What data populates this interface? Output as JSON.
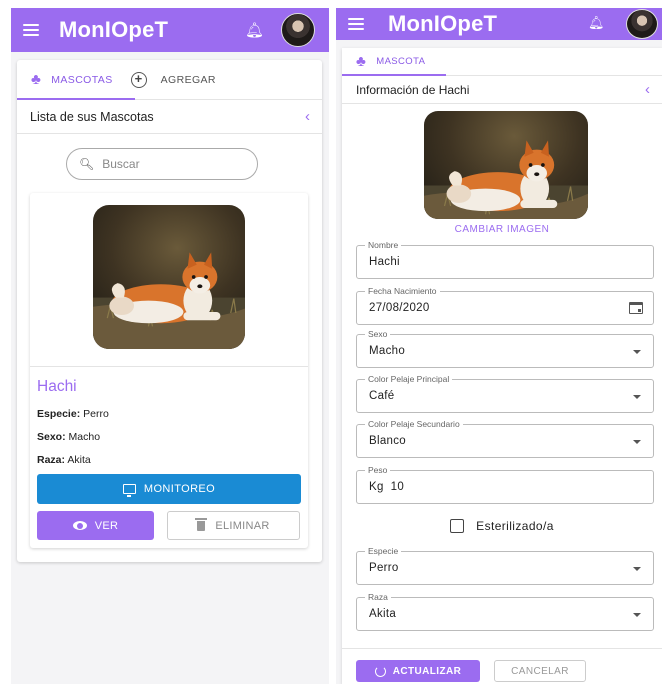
{
  "app": {
    "brand": "MonIOpeT"
  },
  "icons": {
    "menu": "hamburger-icon",
    "notifications": "bell-icon",
    "avatar": "user-avatar",
    "paw": "paw-icon",
    "add": "plus-circle-icon",
    "back": "chevron-left-icon",
    "search": "search-icon",
    "monitor": "monitor-icon",
    "view": "eye-icon",
    "delete": "trash-icon",
    "calendar": "calendar-icon",
    "dropdown": "caret-down-icon",
    "refresh": "refresh-icon"
  },
  "colors": {
    "primary": "#9b6cf0",
    "info": "#1a8bd4"
  },
  "list_view": {
    "tabs": [
      {
        "label": "MASCOTAS"
      },
      {
        "label": "AGREGAR"
      }
    ],
    "section_title": "Lista de sus Mascotas",
    "search": {
      "placeholder": "Buscar"
    },
    "pet": {
      "name": "Hachi",
      "especie_label": "Especie:",
      "especie": "Perro",
      "sexo_label": "Sexo:",
      "sexo": "Macho",
      "raza_label": "Raza:",
      "raza": "Akita"
    },
    "buttons": {
      "monitoreo": "MONITOREO",
      "ver": "VER",
      "eliminar": "ELIMINAR"
    }
  },
  "detail_view": {
    "tab": "MASCOTA",
    "section_title": "Información de Hachi",
    "change_image": "CAMBIAR IMAGEN",
    "fields": {
      "nombre": {
        "label": "Nombre",
        "value": "Hachi"
      },
      "fecha": {
        "label": "Fecha Nacimiento",
        "value": "27/08/2020"
      },
      "sexo": {
        "label": "Sexo",
        "value": "Macho"
      },
      "color1": {
        "label": "Color Pelaje Principal",
        "value": "Café"
      },
      "color2": {
        "label": "Color Pelaje Secundario",
        "value": "Blanco"
      },
      "peso": {
        "label": "Peso",
        "value": "Kg  10"
      },
      "especie": {
        "label": "Especie",
        "value": "Perro"
      },
      "raza": {
        "label": "Raza",
        "value": "Akita"
      }
    },
    "esterilizado": {
      "label": "Esterilizado/a",
      "checked": false
    },
    "buttons": {
      "actualizar": "ACTUALIZAR",
      "cancelar": "CANCELAR"
    }
  }
}
